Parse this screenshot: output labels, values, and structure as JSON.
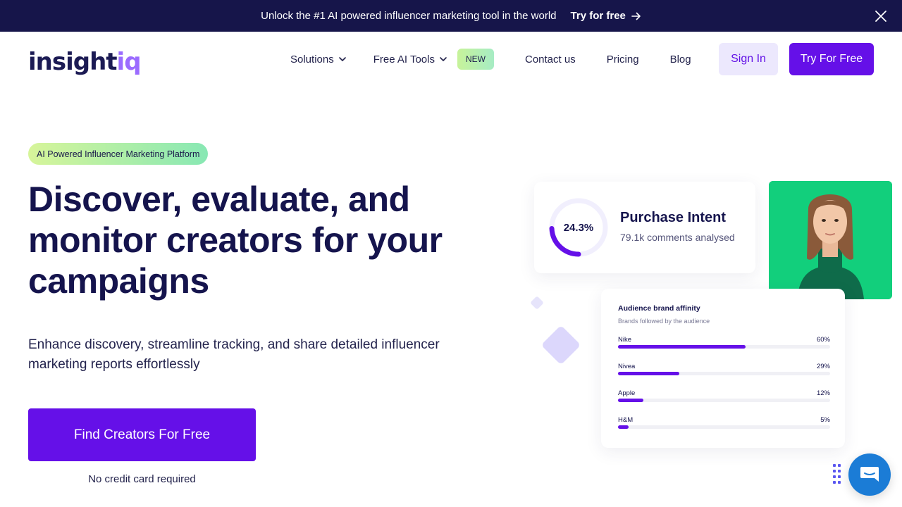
{
  "banner": {
    "text": "Unlock the #1 AI powered influencer marketing tool in the world",
    "cta": "Try for free",
    "bg_color": "#16154a"
  },
  "logo": {
    "main": "insight",
    "suffix": "iq"
  },
  "nav": {
    "items": [
      {
        "label": "Solutions",
        "has_dropdown": true
      },
      {
        "label": "Free AI Tools",
        "has_dropdown": true,
        "badge": "NEW"
      },
      {
        "label": "Contact us"
      },
      {
        "label": "Pricing"
      },
      {
        "label": "Blog"
      }
    ],
    "sign_in": "Sign In",
    "try_free": "Try For Free",
    "accent_color": "#6510e8"
  },
  "hero": {
    "pill": "AI Powered Influencer Marketing Platform",
    "headline_lines": [
      "Discover, evaluate, and",
      "monitor creators for your",
      "campaigns"
    ],
    "subtext": "Enhance discovery, streamline tracking, and share detailed influencer marketing reports effortlessly",
    "cta": "Find Creators For Free",
    "note": "No credit card required"
  },
  "purchase_intent": {
    "percent_label": "24.3%",
    "percent_value": 24.3,
    "title": "Purchase Intent",
    "subtitle": "79.1k comments analysed"
  },
  "affinity": {
    "title": "Audience brand affinity",
    "subtitle": "Brands followed by the audience",
    "rows": [
      {
        "name": "Nike",
        "pct": "60%",
        "value": 60
      },
      {
        "name": "Nivea",
        "pct": "29%",
        "value": 29
      },
      {
        "name": "Apple",
        "pct": "12%",
        "value": 12
      },
      {
        "name": "H&M",
        "pct": "5%",
        "value": 5
      }
    ]
  },
  "icons": {
    "banner_arrow": "arrow-right-icon",
    "banner_close": "close-icon",
    "dropdown": "chevron-down-icon",
    "chat": "chat-bubble-icon"
  }
}
